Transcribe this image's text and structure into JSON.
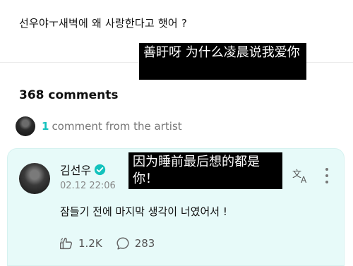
{
  "post": {
    "text": "선우야ㅜ새벽에 왜 사랑한다고 햇어 ?"
  },
  "overlays": {
    "first": "善盱呀 为什么凌晨说我爱你",
    "second": "因为睡前最后想的都是你！"
  },
  "comments": {
    "count_label": "368 comments",
    "artist_count": "1",
    "artist_label": "comment from the artist"
  },
  "artist_comment": {
    "name": "김선우",
    "date": "02.12 22:06",
    "text": "잠들기 전에 마지막 생각이 너였어서 !",
    "likes": "1.2K",
    "replies": "283"
  },
  "colors": {
    "accent": "#13c2bd",
    "card_background": "#e7faf9"
  },
  "icons": {
    "verified": "verified-badge-icon",
    "translate": "translate-icon",
    "more": "more-vertical-icon",
    "like": "like-icon",
    "reply": "reply-bubble-icon"
  }
}
